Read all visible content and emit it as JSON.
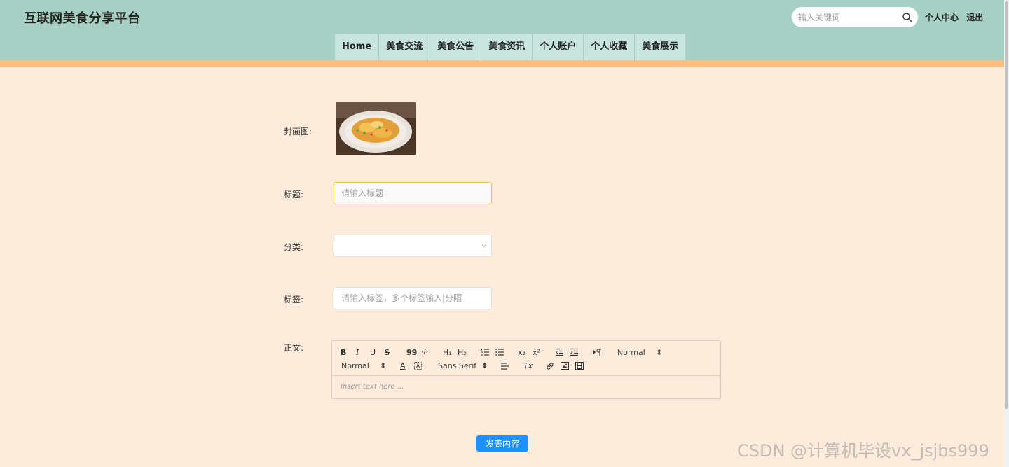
{
  "site": {
    "title": "互联网美食分享平台"
  },
  "search": {
    "placeholder": "输入关键词"
  },
  "top_links": {
    "profile": "个人中心",
    "logout": "退出"
  },
  "nav": {
    "items": [
      "Home",
      "美食交流",
      "美食公告",
      "美食资讯",
      "个人账户",
      "个人收藏",
      "美食展示"
    ]
  },
  "form": {
    "cover_label": "封面图:",
    "title_label": "标题:",
    "title_placeholder": "请输入标题",
    "category_label": "分类:",
    "category_value": "",
    "tags_label": "标签:",
    "tags_placeholder": "请输入标签，多个标签输入|分隔",
    "content_label": "正文:"
  },
  "editor": {
    "header_picker": "Normal",
    "size_picker": "Normal",
    "font_picker": "Sans Serif",
    "placeholder": "Insert text here ...",
    "tools": {
      "bold": "B",
      "italic": "I",
      "underline": "U",
      "strike": "S",
      "quote": "99",
      "code": "‹/›",
      "h1": "H₁",
      "h2": "H₂",
      "sub": "x₂",
      "sup": "x²",
      "color": "A",
      "clean": "Tx"
    }
  },
  "submit": {
    "label": "发表内容"
  },
  "watermark": "CSDN @计算机毕设vx_jsjbs999",
  "colors": {
    "header": "#a6d0c3",
    "nav_item": "#c7e5de",
    "stripe": "#fbbf85",
    "background": "#fdebdb",
    "primary": "#1e90ff"
  }
}
